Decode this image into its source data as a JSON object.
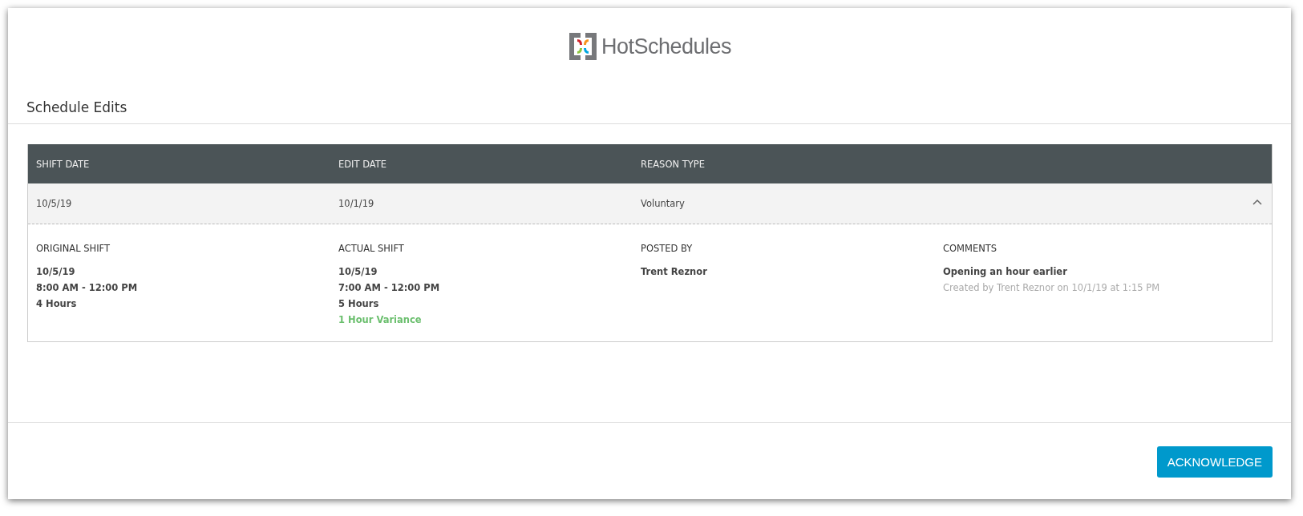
{
  "logo": {
    "text": "HotSchedules"
  },
  "section": {
    "title": "Schedule Edits"
  },
  "table": {
    "columns": [
      "SHIFT DATE",
      "EDIT DATE",
      "REASON TYPE"
    ],
    "rows": [
      {
        "cells": [
          "10/5/19",
          "10/1/19",
          "Voluntary"
        ],
        "expanded": true,
        "details": [
          {
            "heading": "ORIGINAL SHIFT",
            "lines": [
              {
                "text": "10/5/19",
                "kind": "plain"
              },
              {
                "text": "8:00 AM - 12:00 PM",
                "kind": "plain"
              },
              {
                "text": "4 Hours",
                "kind": "plain"
              }
            ]
          },
          {
            "heading": "ACTUAL SHIFT",
            "lines": [
              {
                "text": "10/5/19",
                "kind": "plain"
              },
              {
                "text": "7:00 AM - 12:00 PM",
                "kind": "plain"
              },
              {
                "text": "5 Hours",
                "kind": "plain"
              },
              {
                "text": "1 Hour Variance",
                "kind": "variance"
              }
            ]
          },
          {
            "heading": "POSTED BY",
            "lines": [
              {
                "text": "Trent Reznor",
                "kind": "plain"
              }
            ]
          },
          {
            "heading": "COMMENTS",
            "lines": [
              {
                "text": "Opening an hour earlier",
                "kind": "plain"
              },
              {
                "text": "Created by Trent Reznor on 10/1/19 at 1:15 PM",
                "kind": "meta"
              }
            ]
          }
        ]
      }
    ]
  },
  "buttons": [
    "ACKNOWLEDGE"
  ]
}
